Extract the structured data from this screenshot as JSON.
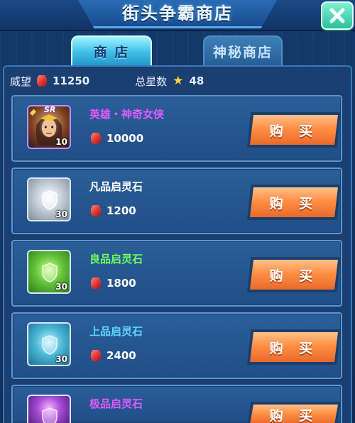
{
  "header": {
    "title": "街头争霸商店",
    "close": "close"
  },
  "tabs": [
    {
      "label": "商 店",
      "active": true
    },
    {
      "label": "神秘商店",
      "active": false
    }
  ],
  "stats": {
    "prestige_label": "威望",
    "prestige_value": "11250",
    "stars_label": "总星数",
    "stars_value": "48"
  },
  "items": [
    {
      "name": "英雄・神奇女侠",
      "name_color": "#e25bff",
      "price": "10000",
      "badge": "SR",
      "count": "10",
      "buy_label": "购 买"
    },
    {
      "name": "凡品启灵石",
      "name_color": "#ffffff",
      "price": "1200",
      "count": "30",
      "buy_label": "购 买"
    },
    {
      "name": "良品启灵石",
      "name_color": "#6fff5a",
      "price": "1800",
      "count": "30",
      "buy_label": "购 买"
    },
    {
      "name": "上品启灵石",
      "name_color": "#5fd6ff",
      "price": "2400",
      "count": "30",
      "buy_label": "购 买"
    },
    {
      "name": "极品启灵石",
      "name_color": "#e25bff",
      "price": "",
      "count": "",
      "buy_label": "购 买"
    }
  ],
  "colors": {
    "accent": "#3fbde6",
    "buy_button": "#ff8f45",
    "currency_gem": "#e23a3a",
    "star": "#ffd43b"
  },
  "icons": {
    "currency": "red-gem-icon",
    "star": "star-icon",
    "close": "close-icon"
  }
}
